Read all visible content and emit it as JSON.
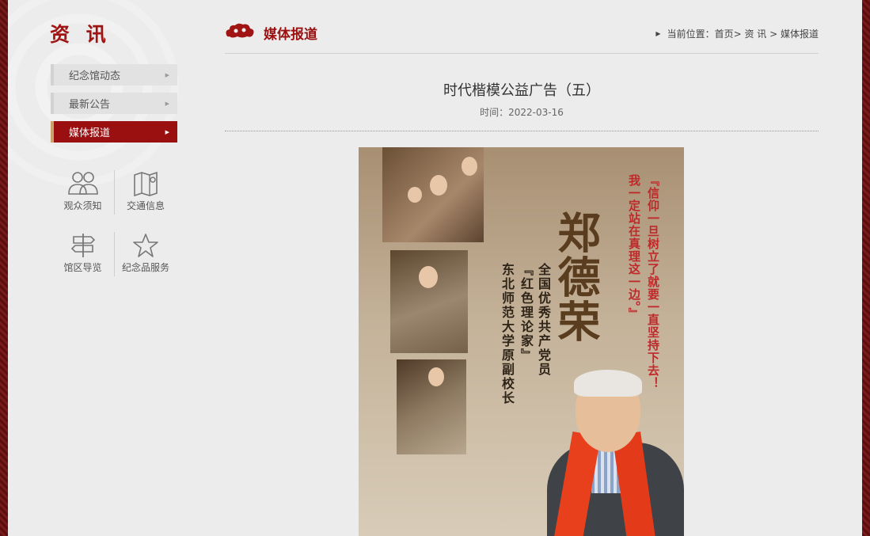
{
  "sidebar": {
    "title": "资 讯",
    "menu": [
      {
        "label": "纪念馆动态",
        "active": false
      },
      {
        "label": "最新公告",
        "active": false
      },
      {
        "label": "媒体报道",
        "active": true
      }
    ],
    "quick_links": [
      {
        "label": "观众须知",
        "icon": "visitors-icon"
      },
      {
        "label": "交通信息",
        "icon": "map-icon"
      },
      {
        "label": "馆区导览",
        "icon": "signpost-icon"
      },
      {
        "label": "纪念品服务",
        "icon": "star-icon"
      }
    ]
  },
  "header": {
    "section_title": "媒体报道",
    "breadcrumb": {
      "prefix": "当前位置：",
      "home": "首页",
      "sep1": "> ",
      "level1": "资 讯",
      "sep2": " > ",
      "current": "媒体报道"
    }
  },
  "article": {
    "title": "时代楷模公益广告（五）",
    "time": "时间：2022-03-16"
  },
  "poster": {
    "name": "郑德荣",
    "desc_line1": "全国优秀共产党员",
    "desc_line2": "『红色理论家』",
    "desc_line3": "东北师范大学原副校长",
    "quote_line1": "『信仰一旦树立了就要一直坚持下去！",
    "quote_line2": "我一定站在真理这一边。』"
  },
  "colors": {
    "brand_red": "#9a1010",
    "frame": "#6b1414",
    "background": "#ececec"
  }
}
